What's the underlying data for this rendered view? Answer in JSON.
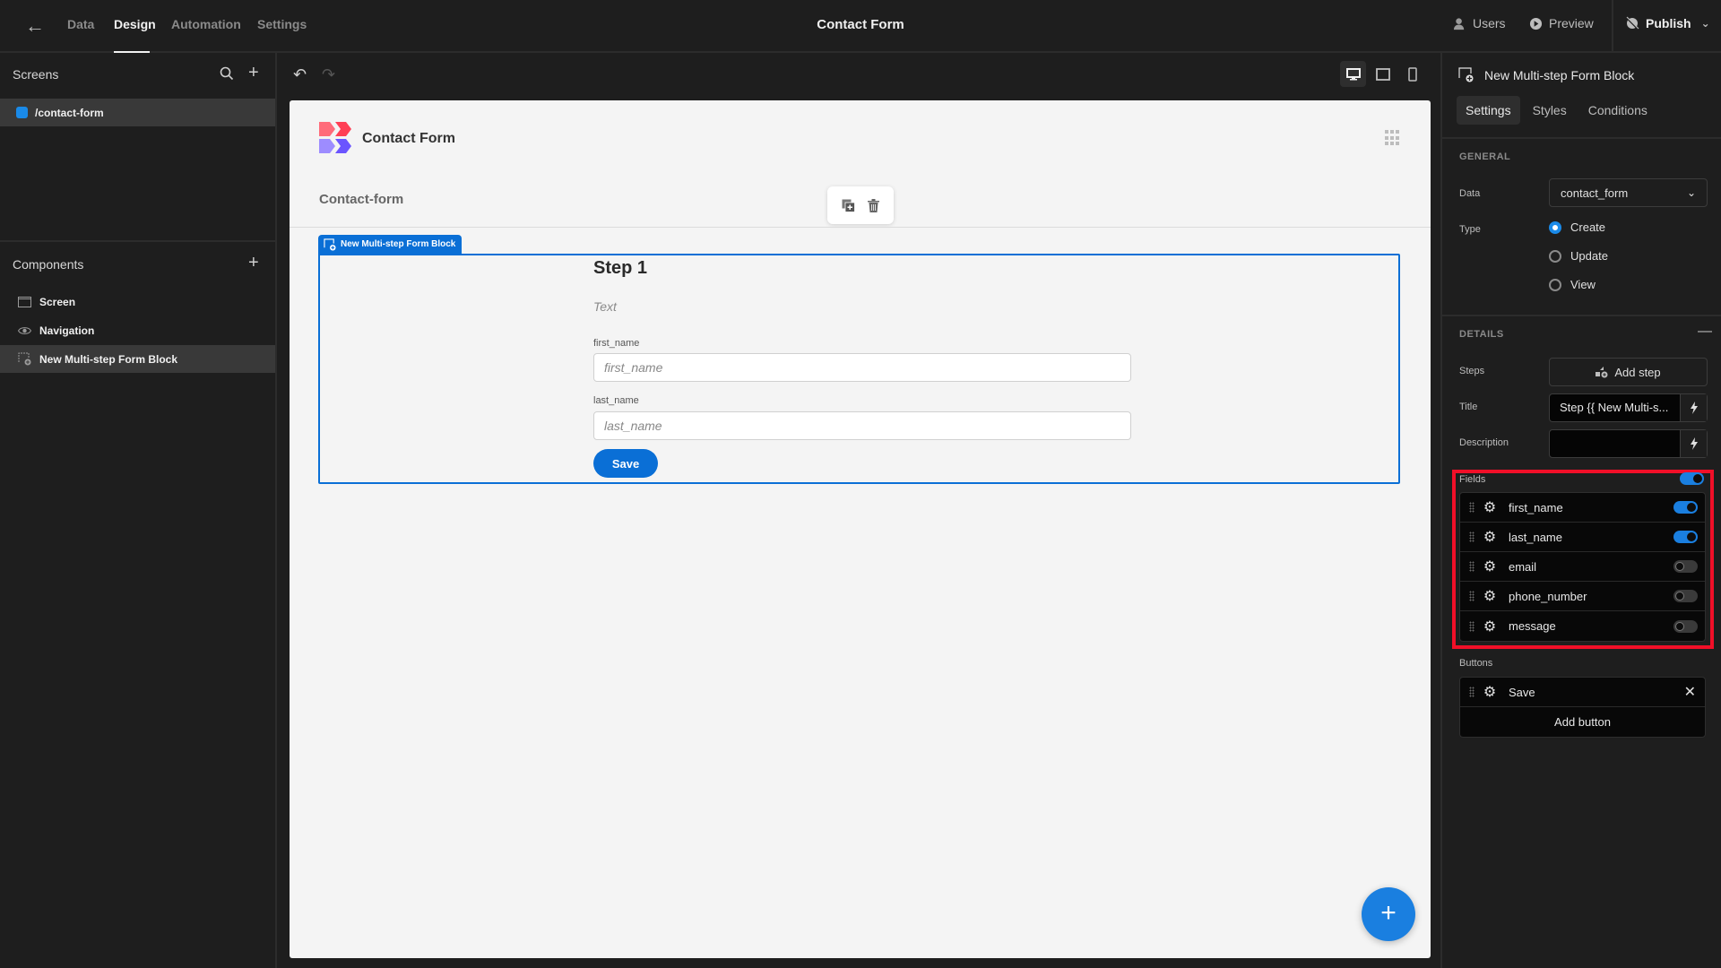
{
  "topbar": {
    "nav": [
      {
        "label": "Data",
        "active": false
      },
      {
        "label": "Design",
        "active": true
      },
      {
        "label": "Automation",
        "active": false
      },
      {
        "label": "Settings",
        "active": false
      }
    ],
    "title": "Contact Form",
    "users_label": "Users",
    "preview_label": "Preview",
    "publish_label": "Publish"
  },
  "left": {
    "screens_title": "Screens",
    "screens": [
      {
        "label": "/contact-form",
        "color": "#1a8ae8",
        "selected": true
      }
    ],
    "components_title": "Components",
    "components": [
      {
        "label": "Screen",
        "icon": "screen-icon",
        "selected": false
      },
      {
        "label": "Navigation",
        "icon": "eye-icon",
        "selected": false
      },
      {
        "label": "New Multi-step Form Block",
        "icon": "form-block-icon",
        "selected": true
      }
    ]
  },
  "canvas": {
    "app_title": "Contact Form",
    "subtitle": "Contact-form",
    "block_tag": "New Multi-step Form Block",
    "step_title": "Step 1",
    "step_description": "Text",
    "fields": [
      {
        "label": "first_name",
        "placeholder": "first_name"
      },
      {
        "label": "last_name",
        "placeholder": "last_name"
      }
    ],
    "save_label": "Save",
    "fab_label": "+"
  },
  "right": {
    "header_title": "New Multi-step Form Block",
    "tabs": [
      {
        "label": "Settings",
        "active": true
      },
      {
        "label": "Styles",
        "active": false
      },
      {
        "label": "Conditions",
        "active": false
      }
    ],
    "general": {
      "title": "GENERAL",
      "data_label": "Data",
      "data_value": "contact_form",
      "type_label": "Type",
      "type_options": [
        {
          "label": "Create",
          "selected": true
        },
        {
          "label": "Update",
          "selected": false
        },
        {
          "label": "View",
          "selected": false
        }
      ]
    },
    "details": {
      "title": "DETAILS",
      "steps_label": "Steps",
      "add_step_label": "Add step",
      "title_label": "Title",
      "title_value": "Step {{ New Multi-s...",
      "description_label": "Description",
      "description_value": "",
      "fields_label": "Fields",
      "fields_all_on": true,
      "fields": [
        {
          "label": "first_name",
          "on": true
        },
        {
          "label": "last_name",
          "on": true
        },
        {
          "label": "email",
          "on": false
        },
        {
          "label": "phone_number",
          "on": false
        },
        {
          "label": "message",
          "on": false
        }
      ],
      "buttons_label": "Buttons",
      "buttons": [
        {
          "label": "Save"
        }
      ],
      "add_button_label": "Add button"
    },
    "highlight_color": "#f10f28",
    "accent_color": "#1a7fe0"
  }
}
